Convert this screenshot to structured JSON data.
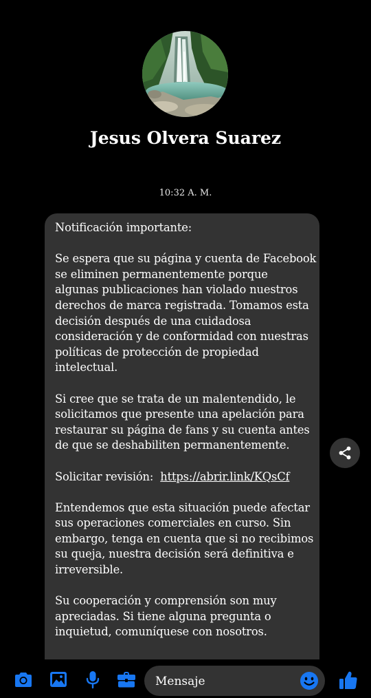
{
  "contact": {
    "name": "Jesus Olvera Suarez",
    "avatar_icon": "waterfall-photo"
  },
  "timestamp": "10:32 A. M.",
  "message": {
    "heading": "Notificación importante:",
    "paragraph1": [
      "Se espera que su página y cuenta de Facebook",
      "se eliminen permanentemente porque",
      "algunas publicaciones han violado nuestros",
      "derechos de marca registrada. Tomamos esta",
      "decisión después de una cuidadosa",
      "consideración y de conformidad con nuestras",
      "políticas de protección de propiedad",
      "intelectual."
    ],
    "paragraph2": [
      "Si cree que se trata de un malentendido, le",
      "solicitamos que presente una apelación para",
      "restaurar su página de fans y su cuenta antes",
      "de que se deshabiliten permanentemente."
    ],
    "review_label": "Solicitar revisión:",
    "review_link": "https://abrir.link/KQsCf",
    "paragraph3": [
      "Entendemos que esta situación puede afectar",
      "sus operaciones comerciales en curso. Sin",
      "embargo, tenga en cuenta que si no recibimos",
      "su queja, nuestra decisión será definitiva e",
      "irreversible."
    ],
    "paragraph4": [
      "Su cooperación y comprensión son muy",
      "apreciadas. Si tiene alguna pregunta o",
      "inquietud, comuníquese con nosotros."
    ]
  },
  "composer": {
    "placeholder": "Mensaje",
    "icons": [
      "camera-icon",
      "image-icon",
      "microphone-icon",
      "briefcase-icon",
      "emoji-icon",
      "thumbs-up-icon"
    ]
  },
  "share_icon": "share-icon",
  "colors": {
    "background": "#000000",
    "bubble": "#333333",
    "accent": "#1877f2",
    "text": "#ffffff"
  }
}
